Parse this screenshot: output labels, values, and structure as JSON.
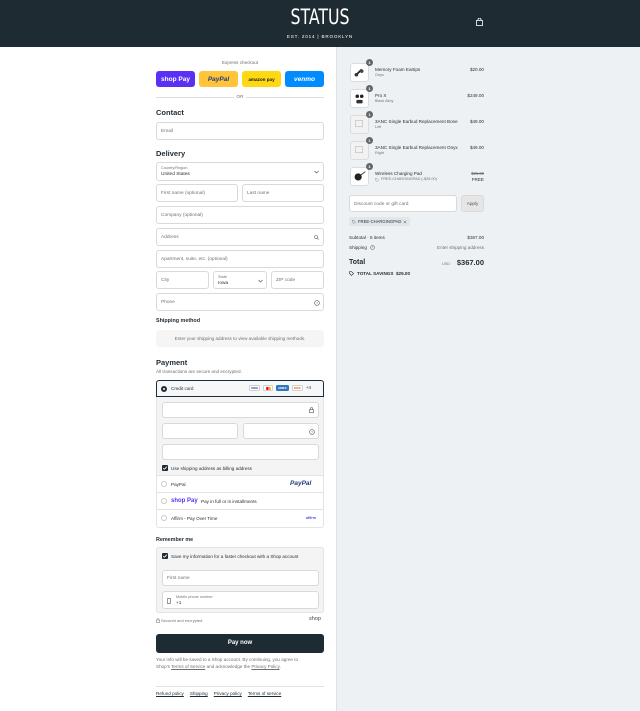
{
  "header": {
    "logo": "STATUS",
    "tagline": "EST. 2014 | BROOKLYN"
  },
  "express": {
    "title": "Express checkout",
    "or": "OR",
    "shop_pay": "shop Pay",
    "paypal": "PayPal",
    "amazon_pay": "amazon pay",
    "venmo": "venmo"
  },
  "contact": {
    "title": "Contact",
    "email_placeholder": "Email"
  },
  "delivery": {
    "title": "Delivery",
    "country_label": "Country/Region",
    "country_value": "United States",
    "first_name": "First name (optional)",
    "last_name": "Last name",
    "company": "Company (optional)",
    "address": "Address",
    "apartment": "Apartment, suite, etc. (optional)",
    "city": "City",
    "state_label": "State",
    "state_value": "Iowa",
    "zip": "ZIP code",
    "phone": "Phone"
  },
  "shipping_method": {
    "title": "Shipping method",
    "notice": "Enter your shipping address to view available shipping methods."
  },
  "payment": {
    "title": "Payment",
    "subtitle": "All transactions are secure and encrypted.",
    "credit_card": "Credit card",
    "card_more": "+4",
    "billing_checkbox": "Use shipping address as billing address",
    "paypal": "PayPal",
    "paypal_logo": "PayPal",
    "shop_pay_logo": "shop Pay",
    "shop_pay_text": "Pay in full or in installments",
    "affirm": "Affirm - Pay Over Time",
    "affirm_logo": "affirm"
  },
  "remember": {
    "title": "Remember me",
    "checkbox": "Save my information for a faster checkout with a Shop account",
    "first_name": "First name",
    "mobile_label": "Mobile phone number",
    "mobile_value": "+1",
    "secure": "Secured and encrypted",
    "shop": "shop"
  },
  "pay_now": "Pay now",
  "disclaimer": {
    "line1": "Your info will be saved to a Shop account. By continuing, you agree to",
    "line2a": "Shop's ",
    "terms": "Terms of Service",
    "line2b": " and acknowledge the ",
    "privacy": "Privacy Policy",
    "period": "."
  },
  "footer_links": [
    "Refund policy",
    "Shipping",
    "Privacy policy",
    "Terms of service"
  ],
  "cart": {
    "items": [
      {
        "qty": "1",
        "name": "Memory Foam Eartips",
        "variant": "Onyx",
        "price": "$20.00"
      },
      {
        "qty": "1",
        "name": "Pro X",
        "variant": "Black Alloy",
        "price": "$249.00"
      },
      {
        "qty": "1",
        "name": "3ANC Single Earbud Replacement Bone",
        "variant": "Left",
        "price": "$49.00"
      },
      {
        "qty": "1",
        "name": "3ANC Single Earbud Replacement Onyx",
        "variant": "Right",
        "price": "$49.00"
      },
      {
        "qty": "1",
        "name": "Wireless Charging Pad",
        "variant": "FREE-CHARGINGPAD (-$25.00)",
        "old_price": "$25.00",
        "price": "FREE"
      }
    ],
    "discount_placeholder": "Discount code or gift card",
    "apply": "Apply",
    "discount_tag": "FREE-CHARGINGPAD",
    "subtotal_label": "Subtotal · 5 items",
    "subtotal_value": "$367.00",
    "shipping_label": "Shipping",
    "shipping_value": "Enter shipping address",
    "total_label": "Total",
    "currency": "USD",
    "total_value": "$367.00",
    "savings_label": "TOTAL SAVINGS",
    "savings_value": "$25.00"
  }
}
